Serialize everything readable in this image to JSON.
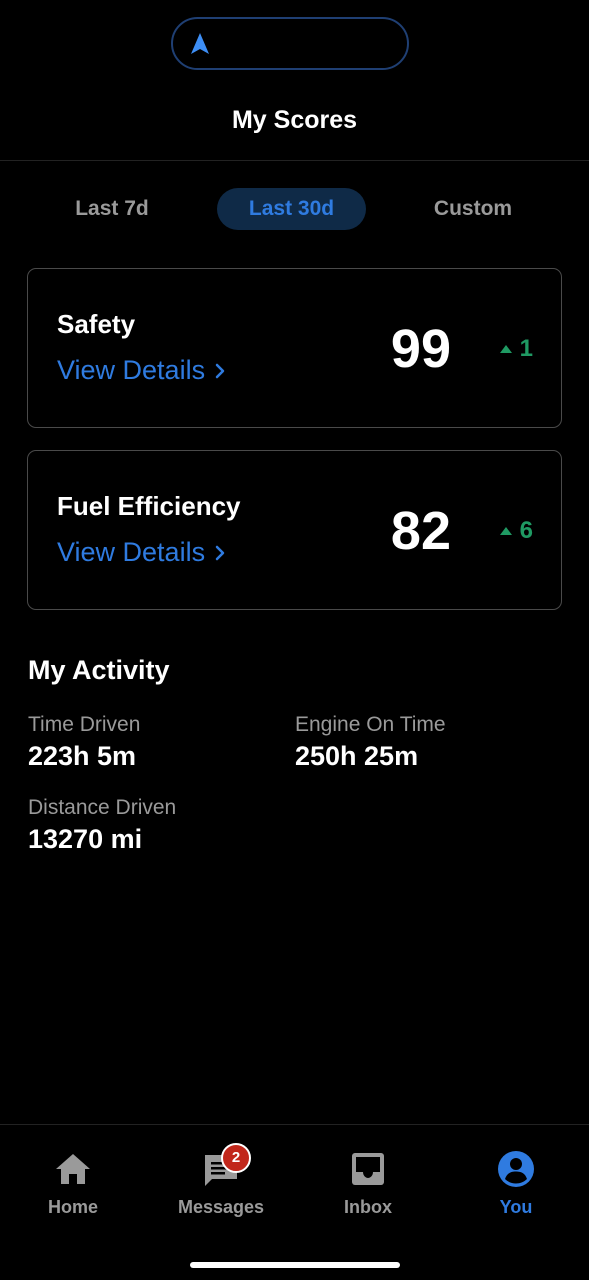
{
  "header": {
    "title": "My Scores"
  },
  "tabs": [
    {
      "label": "Last 7d",
      "selected": false
    },
    {
      "label": "Last 30d",
      "selected": true
    },
    {
      "label": "Custom",
      "selected": false
    }
  ],
  "scores": [
    {
      "title": "Safety",
      "link": "View Details",
      "score": "99",
      "delta": "1",
      "trend": "up"
    },
    {
      "title": "Fuel Efficiency",
      "link": "View Details",
      "score": "82",
      "delta": "6",
      "trend": "up"
    }
  ],
  "activity": {
    "title": "My Activity",
    "time_driven": {
      "label": "Time Driven",
      "value": "223h 5m"
    },
    "engine_on_time": {
      "label": "Engine On Time",
      "value": "250h 25m"
    },
    "distance_driven": {
      "label": "Distance Driven",
      "value": "13270 mi"
    }
  },
  "bottom_nav": [
    {
      "label": "Home",
      "icon": "home-icon",
      "active": false
    },
    {
      "label": "Messages",
      "icon": "messages-icon",
      "active": false,
      "badge": "2"
    },
    {
      "label": "Inbox",
      "icon": "inbox-icon",
      "active": false
    },
    {
      "label": "You",
      "icon": "user-icon",
      "active": true
    }
  ],
  "colors": {
    "accent": "#2f7be0",
    "positive": "#1f9a63",
    "badge": "#c1271b",
    "background": "#000000"
  }
}
